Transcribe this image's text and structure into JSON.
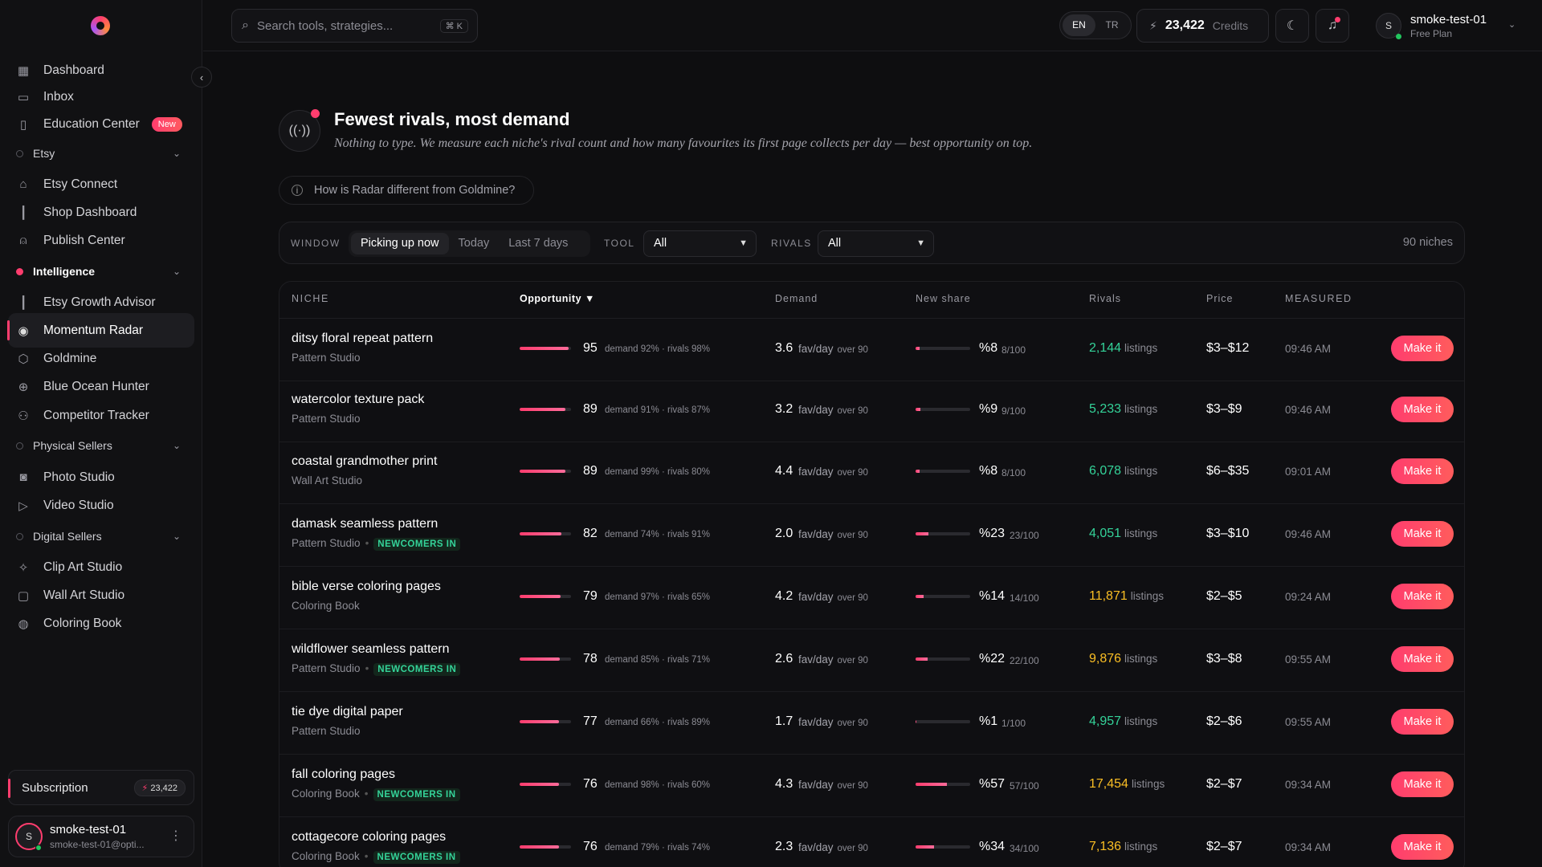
{
  "sidebar": {
    "items_top": [
      {
        "label": "Dashboard",
        "icon": "grid-icon"
      },
      {
        "label": "Inbox",
        "icon": "inbox-icon"
      },
      {
        "label": "Education Center",
        "icon": "book-icon",
        "badge": "New"
      }
    ],
    "groups": [
      {
        "label": "Etsy",
        "items": [
          "Etsy Connect",
          "Shop Dashboard",
          "Publish Center"
        ]
      },
      {
        "label": "Intelligence",
        "items": [
          "Etsy Growth Advisor",
          "Momentum Radar",
          "Goldmine",
          "Blue Ocean Hunter",
          "Competitor Tracker"
        ]
      },
      {
        "label": "Physical Sellers",
        "items": [
          "Photo Studio",
          "Video Studio"
        ]
      },
      {
        "label": "Digital Sellers",
        "items": [
          "Clip Art Studio",
          "Wall Art Studio",
          "Coloring Book"
        ]
      }
    ],
    "active_item": "Momentum Radar",
    "subscription": {
      "label": "Subscription",
      "credits": "23,422"
    },
    "user": {
      "initial": "S",
      "name": "smoke-test-01",
      "email": "smoke-test-01@opti..."
    }
  },
  "topbar": {
    "search_placeholder": "Search tools, strategies...",
    "shortcut": "⌘ K",
    "languages": [
      "EN",
      "TR"
    ],
    "active_language": "EN",
    "credits_value": "23,422",
    "credits_label": "Credits",
    "user": {
      "initial": "S",
      "name": "smoke-test-01",
      "plan": "Free Plan"
    }
  },
  "hero": {
    "title": "Fewest rivals, most demand",
    "subtitle": "Nothing to type. We measure each niche's rival count and how many favourites its first page collects per day — best opportunity on top.",
    "info": "How is Radar different from Goldmine?"
  },
  "filters": {
    "window_label": "WINDOW",
    "windows": [
      "Picking up now",
      "Today",
      "Last 7 days"
    ],
    "active_window": "Picking up now",
    "tool_label": "TOOL",
    "tool_value": "All",
    "rivals_label": "RIVALS",
    "rivals_value": "All",
    "count": "90 niches"
  },
  "table": {
    "headers": {
      "niche": "NICHE",
      "opportunity": "Opportunity ▼",
      "demand": "Demand",
      "new_share": "New share",
      "rivals": "Rivals",
      "price": "Price",
      "measured": "MEASURED"
    },
    "unit_favday": "fav/day",
    "unit_listings": "listings",
    "action_label": "Make it",
    "newcomers_label": "NEWCOMERS IN",
    "rows": [
      {
        "niche": "ditsy floral repeat pattern",
        "tool": "Pattern Studio",
        "newcomers": false,
        "opportunity": 95,
        "opp_detail": "demand 92% · rivals 98%",
        "demand": "3.6",
        "demand_note": "over 90",
        "share": "%8",
        "share_sub": "8/100",
        "share_frac": 0.08,
        "rivals": "2,144",
        "rival_color": "green",
        "price": "$3–$12",
        "measured": "09:46 AM"
      },
      {
        "niche": "watercolor texture pack",
        "tool": "Pattern Studio",
        "newcomers": false,
        "opportunity": 89,
        "opp_detail": "demand 91% · rivals 87%",
        "demand": "3.2",
        "demand_note": "over 90",
        "share": "%9",
        "share_sub": "9/100",
        "share_frac": 0.09,
        "rivals": "5,233",
        "rival_color": "green",
        "price": "$3–$9",
        "measured": "09:46 AM"
      },
      {
        "niche": "coastal grandmother print",
        "tool": "Wall Art Studio",
        "newcomers": false,
        "opportunity": 89,
        "opp_detail": "demand 99% · rivals 80%",
        "demand": "4.4",
        "demand_note": "over 90",
        "share": "%8",
        "share_sub": "8/100",
        "share_frac": 0.08,
        "rivals": "6,078",
        "rival_color": "green",
        "price": "$6–$35",
        "measured": "09:01 AM"
      },
      {
        "niche": "damask seamless pattern",
        "tool": "Pattern Studio",
        "newcomers": true,
        "opportunity": 82,
        "opp_detail": "demand 74% · rivals 91%",
        "demand": "2.0",
        "demand_note": "over 90",
        "share": "%23",
        "share_sub": "23/100",
        "share_frac": 0.23,
        "rivals": "4,051",
        "rival_color": "green",
        "price": "$3–$10",
        "measured": "09:46 AM"
      },
      {
        "niche": "bible verse coloring pages",
        "tool": "Coloring Book",
        "newcomers": false,
        "opportunity": 79,
        "opp_detail": "demand 97% · rivals 65%",
        "demand": "4.2",
        "demand_note": "over 90",
        "share": "%14",
        "share_sub": "14/100",
        "share_frac": 0.14,
        "rivals": "11,871",
        "rival_color": "amber",
        "price": "$2–$5",
        "measured": "09:24 AM"
      },
      {
        "niche": "wildflower seamless pattern",
        "tool": "Pattern Studio",
        "newcomers": true,
        "opportunity": 78,
        "opp_detail": "demand 85% · rivals 71%",
        "demand": "2.6",
        "demand_note": "over 90",
        "share": "%22",
        "share_sub": "22/100",
        "share_frac": 0.22,
        "rivals": "9,876",
        "rival_color": "amber",
        "price": "$3–$8",
        "measured": "09:55 AM"
      },
      {
        "niche": "tie dye digital paper",
        "tool": "Pattern Studio",
        "newcomers": false,
        "opportunity": 77,
        "opp_detail": "demand 66% · rivals 89%",
        "demand": "1.7",
        "demand_note": "over 90",
        "share": "%1",
        "share_sub": "1/100",
        "share_frac": 0.01,
        "rivals": "4,957",
        "rival_color": "green",
        "price": "$2–$6",
        "measured": "09:55 AM"
      },
      {
        "niche": "fall coloring pages",
        "tool": "Coloring Book",
        "newcomers": true,
        "opportunity": 76,
        "opp_detail": "demand 98% · rivals 60%",
        "demand": "4.3",
        "demand_note": "over 90",
        "share": "%57",
        "share_sub": "57/100",
        "share_frac": 0.57,
        "rivals": "17,454",
        "rival_color": "amber",
        "price": "$2–$7",
        "measured": "09:34 AM"
      },
      {
        "niche": "cottagecore coloring pages",
        "tool": "Coloring Book",
        "newcomers": true,
        "opportunity": 76,
        "opp_detail": "demand 79% · rivals 74%",
        "demand": "2.3",
        "demand_note": "over 90",
        "share": "%34",
        "share_sub": "34/100",
        "share_frac": 0.34,
        "rivals": "7,136",
        "rival_color": "amber",
        "price": "$2–$7",
        "measured": "09:34 AM"
      }
    ]
  }
}
